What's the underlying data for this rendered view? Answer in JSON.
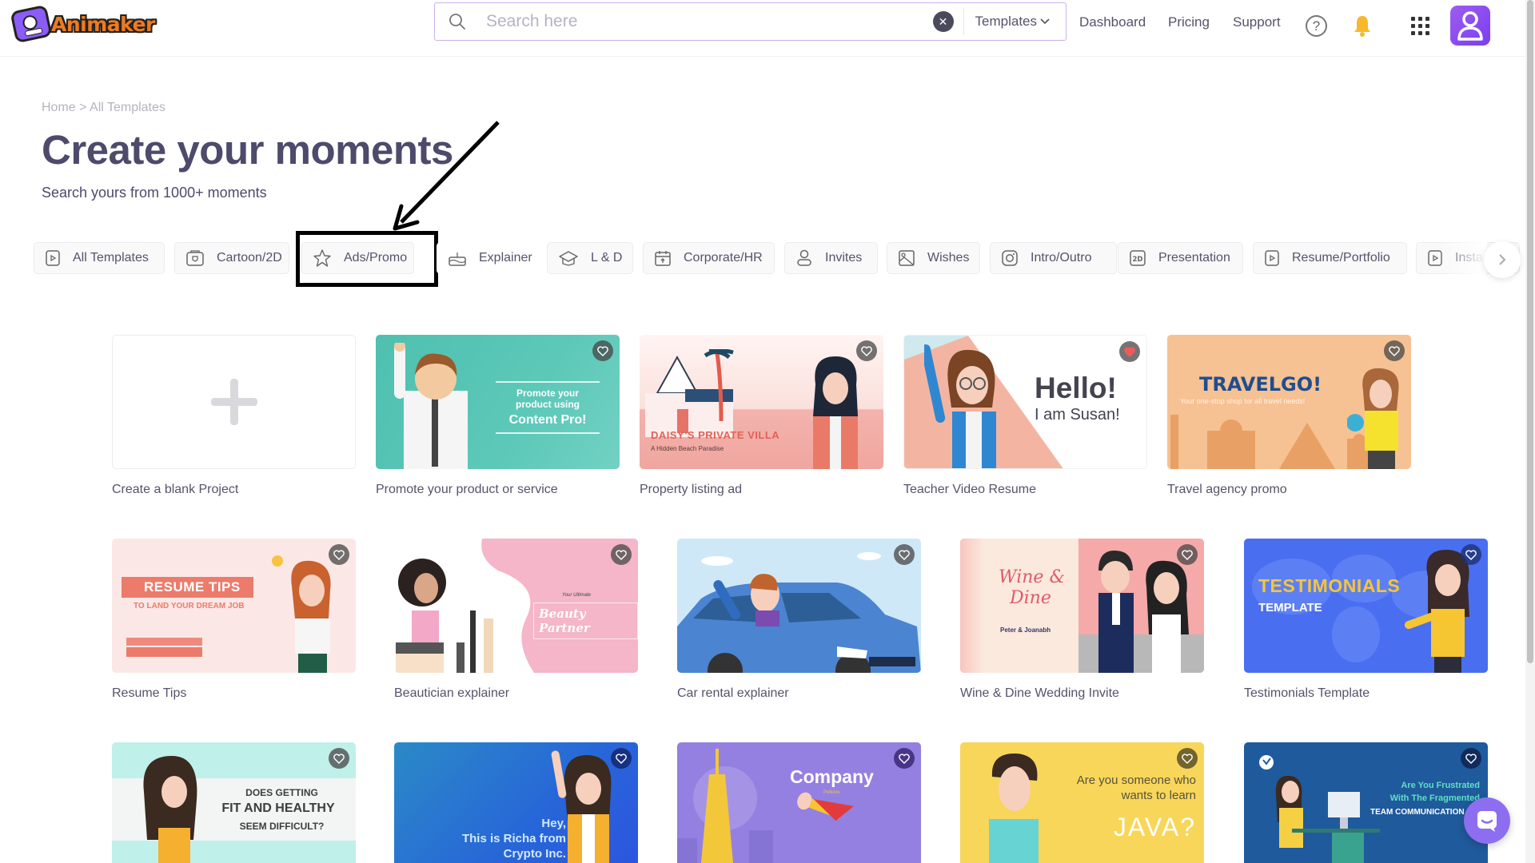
{
  "app": {
    "name": "Animaker"
  },
  "header": {
    "search_placeholder": "Search here",
    "search_value": "",
    "search_scope": "Templates",
    "nav": [
      "Dashboard",
      "Pricing",
      "Support"
    ],
    "help_label": "?"
  },
  "breadcrumb": "Home > All Templates",
  "title": "Create your moments",
  "subtitle": "Search yours from 1000+ moments",
  "categories": [
    {
      "label": "All Templates",
      "icon": "play-square-icon"
    },
    {
      "label": "Cartoon/2D",
      "icon": "cartoon-icon"
    },
    {
      "label": "Ads/Promo",
      "icon": "star-icon",
      "highlighted": true
    },
    {
      "label": "Explainer",
      "icon": "cake-icon"
    },
    {
      "label": "L & D",
      "icon": "graduation-cap-icon"
    },
    {
      "label": "Corporate/HR",
      "icon": "calendar-icon"
    },
    {
      "label": "Invites",
      "icon": "person-icon"
    },
    {
      "label": "Wishes",
      "icon": "image-icon"
    },
    {
      "label": "Intro/Outro",
      "icon": "instagram-icon"
    },
    {
      "label": "Presentation",
      "icon": "2d-icon"
    },
    {
      "label": "Resume/Portfolio",
      "icon": "play-square-icon"
    },
    {
      "label": "Insta",
      "icon": "play-square-icon"
    }
  ],
  "templates": [
    {
      "title": "Create a blank Project",
      "blank": true
    },
    {
      "title": "Promote your product or service",
      "thumb_text": [
        "Promote your",
        "product using",
        "Content Pro!"
      ],
      "bg": "#5cc8b8",
      "favorited": false
    },
    {
      "title": "Property listing ad",
      "thumb_text": [
        "DAISY'S PRIVATE VILLA",
        "A Hidden Beach Paradise"
      ],
      "bg": "#f6c8c4",
      "favorited": false
    },
    {
      "title": "Teacher Video Resume",
      "thumb_text": [
        "Hello!",
        "I am Susan!"
      ],
      "bg": "#ffffff",
      "favorited": true
    },
    {
      "title": "Travel agency promo",
      "thumb_text": [
        "TRAVELGO!",
        "Your one-stop shop for all travel needs!"
      ],
      "bg": "#f6c193",
      "favorited": false
    },
    {
      "title": "Resume Tips",
      "thumb_text": [
        "RESUME TIPS",
        "TO LAND YOUR DREAM JOB"
      ],
      "bg": "#fbe5e4",
      "favorited": false
    },
    {
      "title": "Beautician explainer",
      "thumb_text": [
        "Your Ultimate",
        "Beauty Partner"
      ],
      "bg": "#f4b6c8",
      "favorited": false
    },
    {
      "title": "Car rental explainer",
      "thumb_text": [],
      "bg": "#cfe8f8",
      "favorited": false
    },
    {
      "title": "Wine & Dine Wedding Invite",
      "thumb_text": [
        "Wine &",
        "Dine",
        "Peter & Joanabh"
      ],
      "bg": "#f5a9a9",
      "favorited": false
    },
    {
      "title": "Testimonials Template",
      "thumb_text": [
        "TESTIMONIALS",
        "TEMPLATE"
      ],
      "bg": "#4a6ef0",
      "favorited": false
    },
    {
      "title": "",
      "thumb_text": [
        "DOES GETTING",
        "FIT AND HEALTHY",
        "SEEM DIFFICULT?"
      ],
      "bg": "#bff0ea",
      "favorited": false
    },
    {
      "title": "",
      "thumb_text": [
        "Hey,",
        "This is Richa from",
        "Crypto Inc."
      ],
      "bg": "#2b7fd6",
      "favorited": false
    },
    {
      "title": "",
      "thumb_text": [
        "Company",
        "Policies"
      ],
      "bg": "#9480e0",
      "favorited": false
    },
    {
      "title": "",
      "thumb_text": [
        "Are you someone who",
        "wants to learn",
        "JAVA?"
      ],
      "bg": "#f8d65a",
      "favorited": false
    },
    {
      "title": "",
      "thumb_text": [
        "Are You Frustrated",
        "With The Fragmented",
        "TEAM COMMUNICATION"
      ],
      "bg": "#1f5a9c",
      "favorited": false
    }
  ],
  "colors": {
    "accent": "#8b5cf6",
    "title": "#4d4a6b",
    "bell": "#f7b82e",
    "favorite_active": "#ef5b5b"
  }
}
